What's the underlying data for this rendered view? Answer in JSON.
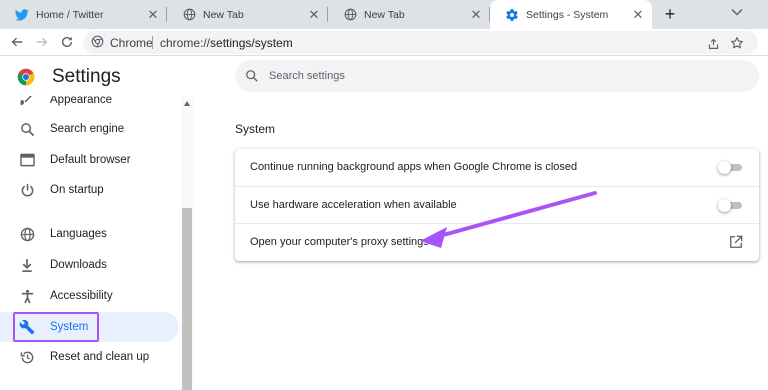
{
  "browser": {
    "tabs": [
      {
        "title": "Home / Twitter",
        "icon": "twitter-icon",
        "active": false
      },
      {
        "title": "New Tab",
        "icon": "globe-icon",
        "active": false
      },
      {
        "title": "New Tab",
        "icon": "globe-icon",
        "active": false
      },
      {
        "title": "Settings - System",
        "icon": "settings-gear-icon",
        "active": true
      }
    ],
    "new_tab_label": "+",
    "omnibox": {
      "site_label": "Chrome",
      "url_scheme": "chrome://",
      "url_path": "settings/system"
    }
  },
  "settings": {
    "title": "Settings",
    "search_placeholder": "Search settings"
  },
  "sidebar": {
    "items": [
      {
        "label": "Appearance",
        "icon": "palette-icon"
      },
      {
        "label": "Search engine",
        "icon": "search-icon"
      },
      {
        "label": "Default browser",
        "icon": "browser-window-icon"
      },
      {
        "label": "On startup",
        "icon": "power-icon"
      },
      {
        "label": "Languages",
        "icon": "globe-icon"
      },
      {
        "label": "Downloads",
        "icon": "download-icon"
      },
      {
        "label": "Accessibility",
        "icon": "accessibility-icon"
      },
      {
        "label": "System",
        "icon": "wrench-icon",
        "selected": true
      },
      {
        "label": "Reset and clean up",
        "icon": "history-icon"
      }
    ]
  },
  "main": {
    "section_title": "System",
    "rows": [
      {
        "label": "Continue running background apps when Google Chrome is closed",
        "control": "toggle",
        "on": false
      },
      {
        "label": "Use hardware acceleration when available",
        "control": "toggle",
        "on": false
      },
      {
        "label": "Open your computer's proxy settings",
        "control": "external-link"
      }
    ]
  },
  "colors": {
    "accent": "#1a73e8",
    "highlight": "#a855f7",
    "selected_bg": "#e8f0fe"
  }
}
